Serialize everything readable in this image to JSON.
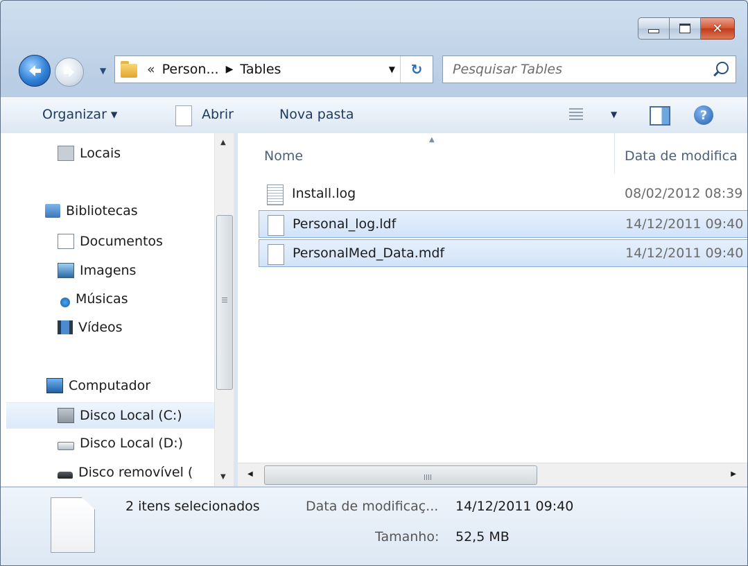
{
  "window": {
    "controls": {
      "minimize": "minimize",
      "maximize": "maximize",
      "close": "close"
    }
  },
  "nav": {
    "path_prefix": "«",
    "path_segments": [
      "Person...",
      "Tables"
    ],
    "search_placeholder": "Pesquisar Tables"
  },
  "toolbar": {
    "organize_label": "Organizar ▾",
    "open_label": "Abrir",
    "new_folder_label": "Nova pasta"
  },
  "navpane": {
    "items": [
      {
        "label": "Locais",
        "icon": "network-places-icon"
      },
      {
        "label": "Bibliotecas",
        "icon": "libraries-icon"
      },
      {
        "label": "Documentos",
        "icon": "documents-icon"
      },
      {
        "label": "Imagens",
        "icon": "pictures-icon"
      },
      {
        "label": "Músicas",
        "icon": "music-icon"
      },
      {
        "label": "Vídeos",
        "icon": "videos-icon"
      },
      {
        "label": "Computador",
        "icon": "computer-icon"
      },
      {
        "label": "Disco Local (C:)",
        "icon": "drive-c-icon",
        "selected": true
      },
      {
        "label": "Disco Local (D:)",
        "icon": "drive-icon"
      },
      {
        "label": "Disco removível (",
        "icon": "removable-drive-icon"
      }
    ]
  },
  "content": {
    "columns": {
      "name": "Nome",
      "date": "Data de modifica"
    },
    "files": [
      {
        "name": "Install.log",
        "date": "08/02/2012 08:39",
        "selected": false
      },
      {
        "name": "Personal_log.ldf",
        "date": "14/12/2011 09:40",
        "selected": true
      },
      {
        "name": "PersonalMed_Data.mdf",
        "date": "14/12/2011 09:40",
        "selected": true
      }
    ]
  },
  "details": {
    "count": "2 itens selecionados",
    "modified_label": "Data de modificaç...",
    "modified_value": "14/12/2011 09:40",
    "size_label": "Tamanho:",
    "size_value": "52,5 MB"
  },
  "colors": {
    "window_frame": "#b9cde4",
    "selection": "#d2e3f8",
    "selection_border": "#84acdd",
    "close_button": "#c2391b"
  }
}
